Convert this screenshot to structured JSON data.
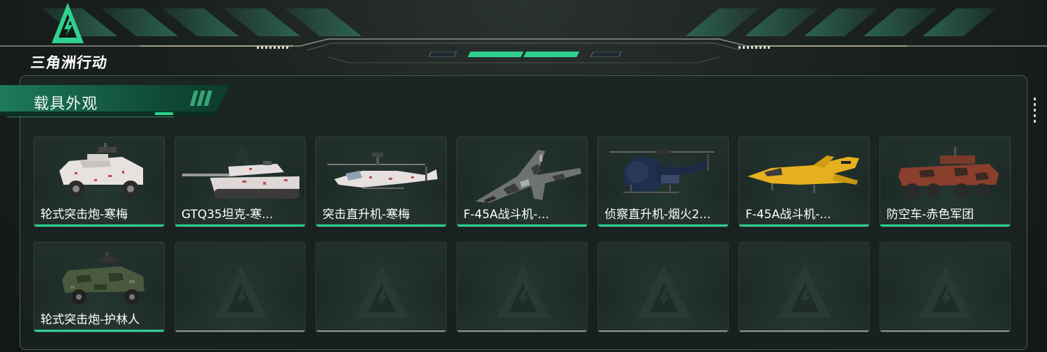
{
  "header": {
    "logo_text": "三角洲行动"
  },
  "section": {
    "title": "载具外观"
  },
  "colors": {
    "accent": "#2fd18f",
    "empty_underline": "#8d9794"
  },
  "vehicles": [
    {
      "label": "轮式突击炮-寒梅",
      "icon": "armored-car-icon"
    },
    {
      "label": "GTQ35坦克-寒...",
      "icon": "tank-icon"
    },
    {
      "label": "突击直升机-寒梅",
      "icon": "attack-helicopter-icon"
    },
    {
      "label": "F-45A战斗机-...",
      "icon": "fighter-jet-icon"
    },
    {
      "label": "侦察直升机-烟火2...",
      "icon": "scout-helicopter-icon"
    },
    {
      "label": "F-45A战斗机-...",
      "icon": "fighter-jet-icon"
    },
    {
      "label": "防空车-赤色军团",
      "icon": "anti-air-vehicle-icon"
    },
    {
      "label": "轮式突击炮-护林人",
      "icon": "armored-car-icon"
    }
  ]
}
